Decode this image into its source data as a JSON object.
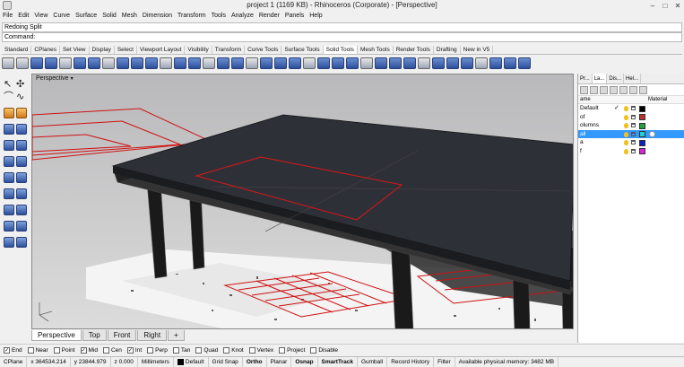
{
  "window": {
    "title": "project 1 (1169 KB) - Rhinoceros (Corporate) - [Perspective]",
    "controls": [
      "–",
      "□",
      "✕"
    ]
  },
  "menu": [
    "File",
    "Edit",
    "View",
    "Curve",
    "Surface",
    "Solid",
    "Mesh",
    "Dimension",
    "Transform",
    "Tools",
    "Analyze",
    "Render",
    "Panels",
    "Help"
  ],
  "command": {
    "history": "Redoing Split",
    "prompt": "Command:",
    "value": ""
  },
  "toolbar_tabs": [
    "Standard",
    "CPlanes",
    "Set View",
    "Display",
    "Select",
    "Viewport Layout",
    "Visibility",
    "Transform",
    "Curve Tools",
    "Surface Tools",
    "Solid Tools",
    "Mesh Tools",
    "Render Tools",
    "Drafting",
    "New in V5"
  ],
  "active_toolbar_tab": "Solid Tools",
  "viewport": {
    "name": "Perspective",
    "tabs": [
      "Perspective",
      "Top",
      "Front",
      "Right",
      "+"
    ]
  },
  "panel": {
    "tabs": [
      "Pr...",
      "La...",
      "Dis...",
      "Hel..."
    ],
    "col_name": "ame",
    "col_material": "Material",
    "layers": [
      {
        "name": "Default",
        "check": "✓",
        "color": "#000000",
        "selected": false
      },
      {
        "name": "of",
        "check": "",
        "color": "#c03030",
        "selected": false
      },
      {
        "name": "olumns",
        "check": "",
        "color": "#20a040",
        "selected": false
      },
      {
        "name": "all",
        "check": "",
        "color": "#20d0d0",
        "selected": true
      },
      {
        "name": "a",
        "check": "",
        "color": "#1020c0",
        "selected": false
      },
      {
        "name": "f",
        "check": "",
        "color": "#e020e0",
        "selected": false
      }
    ]
  },
  "osnaps": [
    {
      "label": "End",
      "checked": true
    },
    {
      "label": "Near",
      "checked": false
    },
    {
      "label": "Point",
      "checked": false
    },
    {
      "label": "Mid",
      "checked": true
    },
    {
      "label": "Cen",
      "checked": false
    },
    {
      "label": "Int",
      "checked": true
    },
    {
      "label": "Perp",
      "checked": false
    },
    {
      "label": "Tan",
      "checked": false
    },
    {
      "label": "Quad",
      "checked": false
    },
    {
      "label": "Knot",
      "checked": false
    },
    {
      "label": "Vertex",
      "checked": false
    },
    {
      "label": "Project",
      "checked": false
    },
    {
      "label": "Disable",
      "checked": false
    }
  ],
  "status": {
    "cplane": "CPlane",
    "x": "x 364534.214",
    "y": "y 23844.979",
    "z": "z 0.000",
    "units": "Millimeters",
    "layer": "Default",
    "grid_snap": "Grid Snap",
    "ortho": "Ortho",
    "planar": "Planar",
    "osnap": "Osnap",
    "smarttrack": "SmartTrack",
    "gumball": "Gumball",
    "record_history": "Record History",
    "filter": "Filter",
    "memory": "Available physical memory: 3482 MB"
  }
}
